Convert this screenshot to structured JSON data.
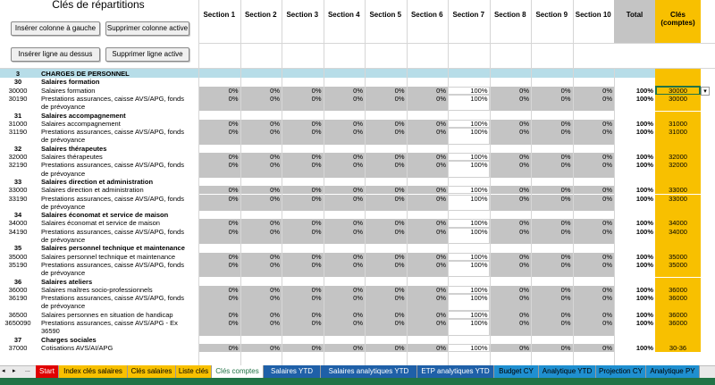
{
  "header": {
    "title": "Clés de répartitions",
    "buttons": {
      "insert_col": "Insérer colonne à gauche",
      "delete_col": "Supprimer colonne active",
      "insert_row": "Insérer ligne au dessus",
      "delete_row": "Supprimer ligne active"
    }
  },
  "columns": {
    "sections": [
      "Section 1",
      "Section 2",
      "Section 3",
      "Section 4",
      "Section 5",
      "Section 6",
      "Section 7",
      "Section 8",
      "Section 9",
      "Section 10"
    ],
    "total": "Total",
    "cles_line1": "Clés",
    "cles_line2": "(comptes)"
  },
  "section_header": {
    "code": "3",
    "label": "CHARGES DE PERSONNEL"
  },
  "groups": [
    {
      "code": "30",
      "label": "Salaires formation",
      "rows": [
        {
          "code": "30000",
          "label": "Salaires formation",
          "label2": "",
          "pcts": [
            "0%",
            "0%",
            "0%",
            "0%",
            "0%",
            "0%",
            "100%",
            "0%",
            "0%",
            "0%"
          ],
          "total": "100%",
          "key": "30000"
        },
        {
          "code": "30190",
          "label": "Prestations assurances, caisse AVS/APG, fonds",
          "label2": "de prévoyance",
          "pcts": [
            "0%",
            "0%",
            "0%",
            "0%",
            "0%",
            "0%",
            "100%",
            "0%",
            "0%",
            "0%"
          ],
          "total": "100%",
          "key": "30000"
        }
      ]
    },
    {
      "code": "31",
      "label": "Salaires accompagnement",
      "rows": [
        {
          "code": "31000",
          "label": "Salaires accompagnement",
          "label2": "",
          "pcts": [
            "0%",
            "0%",
            "0%",
            "0%",
            "0%",
            "0%",
            "100%",
            "0%",
            "0%",
            "0%"
          ],
          "total": "100%",
          "key": "31000"
        },
        {
          "code": "31190",
          "label": "Prestations assurances, caisse AVS/APG, fonds",
          "label2": "de prévoyance",
          "pcts": [
            "0%",
            "0%",
            "0%",
            "0%",
            "0%",
            "0%",
            "100%",
            "0%",
            "0%",
            "0%"
          ],
          "total": "100%",
          "key": "31000"
        }
      ]
    },
    {
      "code": "32",
      "label": "Salaires thérapeutes",
      "rows": [
        {
          "code": "32000",
          "label": "Salaires thérapeutes",
          "label2": "",
          "pcts": [
            "0%",
            "0%",
            "0%",
            "0%",
            "0%",
            "0%",
            "100%",
            "0%",
            "0%",
            "0%"
          ],
          "total": "100%",
          "key": "32000"
        },
        {
          "code": "32190",
          "label": "Prestations assurances, caisse AVS/APG, fonds",
          "label2": "de prévoyance",
          "pcts": [
            "0%",
            "0%",
            "0%",
            "0%",
            "0%",
            "0%",
            "100%",
            "0%",
            "0%",
            "0%"
          ],
          "total": "100%",
          "key": "32000"
        }
      ]
    },
    {
      "code": "33",
      "label": "Salaires direction et administration",
      "rows": [
        {
          "code": "33000",
          "label": "Salaires direction et administration",
          "label2": "",
          "pcts": [
            "0%",
            "0%",
            "0%",
            "0%",
            "0%",
            "0%",
            "100%",
            "0%",
            "0%",
            "0%"
          ],
          "total": "100%",
          "key": "33000"
        },
        {
          "code": "33190",
          "label": "Prestations assurances, caisse AVS/APG, fonds",
          "label2": "de prévoyance",
          "pcts": [
            "0%",
            "0%",
            "0%",
            "0%",
            "0%",
            "0%",
            "100%",
            "0%",
            "0%",
            "0%"
          ],
          "total": "100%",
          "key": "33000"
        }
      ]
    },
    {
      "code": "34",
      "label": "Salaires économat et service de maison",
      "rows": [
        {
          "code": "34000",
          "label": "Salaires économat et service de maison",
          "label2": "",
          "pcts": [
            "0%",
            "0%",
            "0%",
            "0%",
            "0%",
            "0%",
            "100%",
            "0%",
            "0%",
            "0%"
          ],
          "total": "100%",
          "key": "34000"
        },
        {
          "code": "34190",
          "label": "Prestations assurances, caisse AVS/APG, fonds",
          "label2": "de prévoyance",
          "pcts": [
            "0%",
            "0%",
            "0%",
            "0%",
            "0%",
            "0%",
            "100%",
            "0%",
            "0%",
            "0%"
          ],
          "total": "100%",
          "key": "34000"
        }
      ]
    },
    {
      "code": "35",
      "label": "Salaires personnel technique et maintenance",
      "rows": [
        {
          "code": "35000",
          "label": "Salaires personnel technique et maintenance",
          "label2": "",
          "pcts": [
            "0%",
            "0%",
            "0%",
            "0%",
            "0%",
            "0%",
            "100%",
            "0%",
            "0%",
            "0%"
          ],
          "total": "100%",
          "key": "35000"
        },
        {
          "code": "35190",
          "label": "Prestations assurances, caisse AVS/APG, fonds",
          "label2": "de prévoyance",
          "pcts": [
            "0%",
            "0%",
            "0%",
            "0%",
            "0%",
            "0%",
            "100%",
            "0%",
            "0%",
            "0%"
          ],
          "total": "100%",
          "key": "35000"
        }
      ]
    },
    {
      "code": "36",
      "label": "Salaires ateliers",
      "rows": [
        {
          "code": "36000",
          "label": "Salaires maîtres socio-professionnels",
          "label2": "",
          "pcts": [
            "0%",
            "0%",
            "0%",
            "0%",
            "0%",
            "0%",
            "100%",
            "0%",
            "0%",
            "0%"
          ],
          "total": "100%",
          "key": "36000"
        },
        {
          "code": "36190",
          "label": "Prestations assurances, caisse AVS/APG, fonds",
          "label2": "de prévoyance",
          "pcts": [
            "0%",
            "0%",
            "0%",
            "0%",
            "0%",
            "0%",
            "100%",
            "0%",
            "0%",
            "0%"
          ],
          "total": "100%",
          "key": "36000"
        },
        {
          "code": "36500",
          "label": "Salaires personnes en situation de handicap",
          "label2": "",
          "pcts": [
            "0%",
            "0%",
            "0%",
            "0%",
            "0%",
            "0%",
            "100%",
            "0%",
            "0%",
            "0%"
          ],
          "total": "100%",
          "key": "36000"
        },
        {
          "code": "3650090",
          "label": "Prestations assurances, caisse AVS/APG - Ex",
          "label2": "36590",
          "pcts": [
            "0%",
            "0%",
            "0%",
            "0%",
            "0%",
            "0%",
            "100%",
            "0%",
            "0%",
            "0%"
          ],
          "total": "100%",
          "key": "36000"
        }
      ]
    },
    {
      "code": "37",
      "label": "Charges sociales",
      "rows": [
        {
          "code": "37000",
          "label": "Cotisations AVS/AI/APG",
          "label2": "",
          "pcts": [
            "0%",
            "0%",
            "0%",
            "0%",
            "0%",
            "0%",
            "100%",
            "0%",
            "0%",
            "0%"
          ],
          "total": "100%",
          "key": "30-36"
        }
      ]
    }
  ],
  "tabs": [
    {
      "label": "Start",
      "bg": "#e00000",
      "fg": "#ffffff"
    },
    {
      "label": "Index clés salaires",
      "bg": "#f8c000",
      "fg": "#000000"
    },
    {
      "label": "Clés salaires",
      "bg": "#f8c000",
      "fg": "#000000"
    },
    {
      "label": "Liste clés",
      "bg": "#f8c000",
      "fg": "#000000"
    },
    {
      "label": "Clés comptes",
      "bg": "#ffffff",
      "fg": "#217346"
    },
    {
      "label": "Salaires YTD",
      "bg": "#1f60a8",
      "fg": "#ffffff"
    },
    {
      "label": "Salaires analytiques YTD",
      "bg": "#1f60a8",
      "fg": "#ffffff"
    },
    {
      "label": "ETP analytiques YTD",
      "bg": "#1f60a8",
      "fg": "#ffffff"
    },
    {
      "label": "Budget CY",
      "bg": "#1f8fd0",
      "fg": "#000000"
    },
    {
      "label": "Analytique YTD",
      "bg": "#1f8fd0",
      "fg": "#000000"
    },
    {
      "label": "Projection CY",
      "bg": "#1f8fd0",
      "fg": "#000000"
    },
    {
      "label": "Analytique PY",
      "bg": "#1f8fd0",
      "fg": "#000000"
    }
  ],
  "nav": {
    "prev": "◂",
    "next": "▸",
    "more": "..."
  },
  "colors": {
    "section_band": "#b7dde8",
    "gray_fill": "#c4c4c4",
    "key_col": "#f8c000",
    "excel_green": "#217346"
  }
}
